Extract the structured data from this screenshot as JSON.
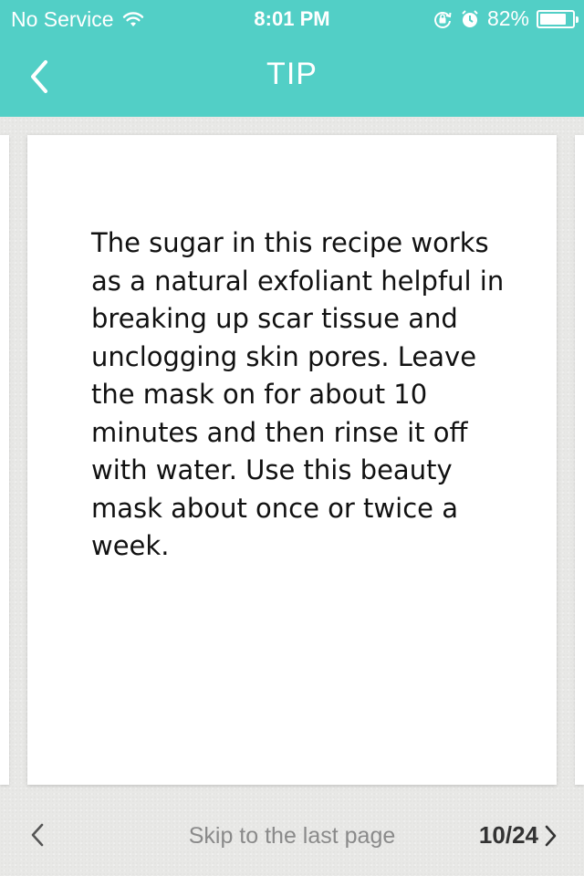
{
  "status_bar": {
    "carrier": "No Service",
    "time": "8:01 PM",
    "battery": "82%",
    "battery_level": 0.82,
    "icons": [
      "wifi-icon",
      "rotation-lock-icon",
      "alarm-icon",
      "battery-icon"
    ]
  },
  "nav": {
    "title": "TIP",
    "back_icon": "chevron-left-icon"
  },
  "card": {
    "text": "The sugar in this recipe works as a natural exfoliant helpful in breaking up scar tissue and unclogging skin pores. Leave the mask on for about 10 minutes and then rinse it off with water. Use this beauty mask about once or twice a week."
  },
  "bottom": {
    "prev_icon": "chevron-left-icon",
    "skip_label": "Skip to the last page",
    "page_counter": "10/24",
    "next_icon": "chevron-right-icon"
  },
  "colors": {
    "accent": "#52cfc6",
    "card": "#ffffff",
    "background": "#e8e8e6"
  }
}
